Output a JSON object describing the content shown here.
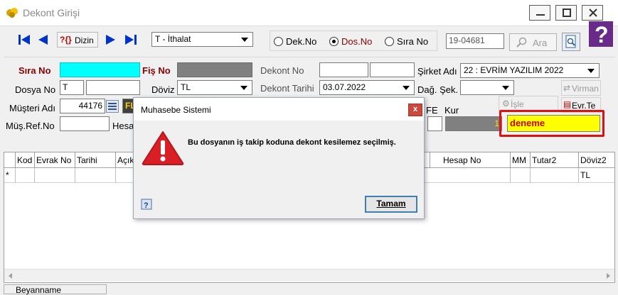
{
  "window": {
    "title": "Dekont Girişi"
  },
  "toolbar": {
    "dizin_prefix": "?{}",
    "dizin_label": "Dizin",
    "type_select": "T - İthalat",
    "radios": [
      {
        "label": "Dek.No",
        "checked": false
      },
      {
        "label": "Dos.No",
        "checked": true
      },
      {
        "label": "Sıra No",
        "checked": false
      }
    ],
    "search_value": "19-04681",
    "search_button": "Ara"
  },
  "form": {
    "sira_no_label": "Sıra No",
    "fis_no_label": "Fiş No",
    "dekont_no_label": "Dekont No",
    "sirket_adi_label": "Şirket Adı",
    "sirket_adi_value": "22 : EVRİM YAZILIM  2022",
    "dosya_no_label": "Dosya No",
    "dosya_no_value": "T",
    "doviz_label": "Döviz",
    "doviz_value": "TL",
    "dekont_tarihi_label": "Dekont Tarihi",
    "dekont_tarihi_value": "03.07.2022",
    "dag_sek_label": "Dağ. Şek.",
    "virman_button": "Virman",
    "musteri_adi_label": "Müşteri Adı",
    "musteri_code": "44176",
    "musteri_name_fragment": "FL",
    "fe_label": "FE",
    "kur_label": "Kur",
    "isle_button": "İşle",
    "evr_button": "Evr.Te",
    "mus_ref_label": "Müş.Ref.No",
    "hesap_label": "Hesa",
    "kur_value": "1",
    "note_value": "deneme"
  },
  "grid": {
    "columns": [
      "Kod",
      "Evrak No",
      "Tarihi",
      "Açık",
      "Hesap No",
      "MM",
      "Tutar2",
      "Döviz2"
    ],
    "row_marker": "*",
    "row_doviz2": "TL"
  },
  "bottom": {
    "tab_label": "Beyanname"
  },
  "dialog": {
    "title": "Muhasebe Sistemi",
    "close": "x",
    "message": "Bu dosyanın iş takip koduna dekont kesilemez seçilmiş.",
    "ok_label": "Tamam"
  },
  "colors": {
    "sira_no_fill": "#00ffff",
    "fis_no_fill": "#808080",
    "note_fill": "#ffff00",
    "note_text": "#d00000",
    "highlight_border": "#e01010"
  }
}
